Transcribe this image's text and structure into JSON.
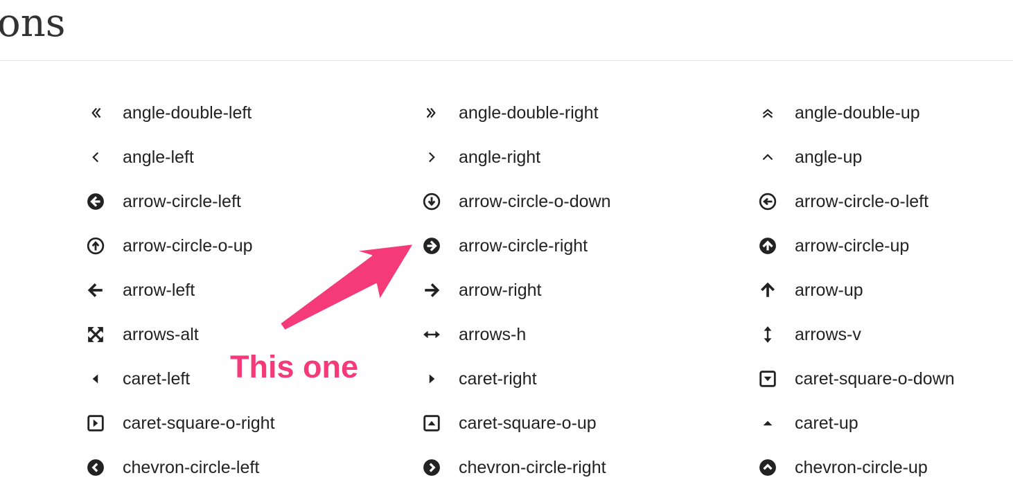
{
  "page": {
    "heading_fragment": "ons"
  },
  "annotation": {
    "text": "This one",
    "color": "#f53a79"
  },
  "icons": [
    {
      "label": "angle-double-left",
      "icon": "angle-double-left-icon"
    },
    {
      "label": "angle-double-right",
      "icon": "angle-double-right-icon"
    },
    {
      "label": "angle-double-up",
      "icon": "angle-double-up-icon"
    },
    {
      "label": "angle-left",
      "icon": "angle-left-icon"
    },
    {
      "label": "angle-right",
      "icon": "angle-right-icon"
    },
    {
      "label": "angle-up",
      "icon": "angle-up-icon"
    },
    {
      "label": "arrow-circle-left",
      "icon": "arrow-circle-left-icon"
    },
    {
      "label": "arrow-circle-o-down",
      "icon": "arrow-circle-o-down-icon"
    },
    {
      "label": "arrow-circle-o-left",
      "icon": "arrow-circle-o-left-icon"
    },
    {
      "label": "arrow-circle-o-up",
      "icon": "arrow-circle-o-up-icon"
    },
    {
      "label": "arrow-circle-right",
      "icon": "arrow-circle-right-icon"
    },
    {
      "label": "arrow-circle-up",
      "icon": "arrow-circle-up-icon"
    },
    {
      "label": "arrow-left",
      "icon": "arrow-left-icon"
    },
    {
      "label": "arrow-right",
      "icon": "arrow-right-icon"
    },
    {
      "label": "arrow-up",
      "icon": "arrow-up-icon"
    },
    {
      "label": "arrows-alt",
      "icon": "arrows-alt-icon"
    },
    {
      "label": "arrows-h",
      "icon": "arrows-h-icon"
    },
    {
      "label": "arrows-v",
      "icon": "arrows-v-icon"
    },
    {
      "label": "caret-left",
      "icon": "caret-left-icon"
    },
    {
      "label": "caret-right",
      "icon": "caret-right-icon"
    },
    {
      "label": "caret-square-o-down",
      "icon": "caret-square-o-down-icon"
    },
    {
      "label": "caret-square-o-right",
      "icon": "caret-square-o-right-icon"
    },
    {
      "label": "caret-square-o-up",
      "icon": "caret-square-o-up-icon"
    },
    {
      "label": "caret-up",
      "icon": "caret-up-icon"
    },
    {
      "label": "chevron-circle-left",
      "icon": "chevron-circle-left-icon"
    },
    {
      "label": "chevron-circle-right",
      "icon": "chevron-circle-right-icon"
    },
    {
      "label": "chevron-circle-up",
      "icon": "chevron-circle-up-icon"
    }
  ]
}
